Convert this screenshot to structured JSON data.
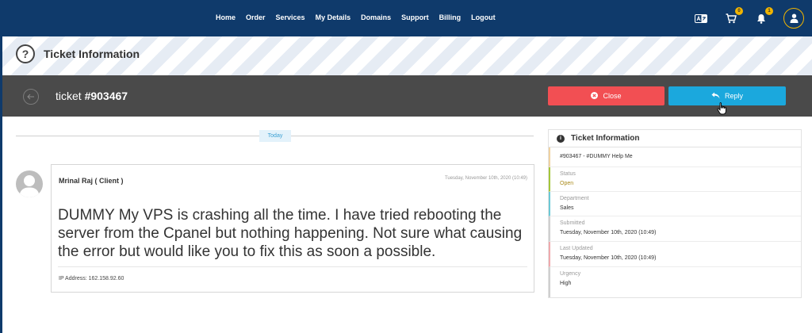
{
  "nav": {
    "items": [
      "Home",
      "Order",
      "Services",
      "My Details",
      "Domains",
      "Support",
      "Billing",
      "Logout"
    ],
    "cart_count": "0",
    "notification_count": "1"
  },
  "header": {
    "title": "Ticket Information"
  },
  "ticket": {
    "title_prefix": "ticket ",
    "number": "#903467",
    "close_label": "Close",
    "reply_label": "Reply"
  },
  "thread": {
    "day_label": "Today",
    "author": "Mrinal Raj ( Client )",
    "date": "Tuesday, November 10th, 2020 (10:49)",
    "body": "DUMMY My VPS is crashing all the time. I have tried rebooting the server from the Cpanel but nothing happening. Not sure what causing the error but would like you to fix this as soon a possible.",
    "ip": "IP Address: 162.158.92.60"
  },
  "side": {
    "title": "Ticket Information",
    "ref": "#903467 - #DUMMY Help Me",
    "rows": [
      {
        "label": "Status",
        "value": "Open"
      },
      {
        "label": "Department",
        "value": "Sales"
      },
      {
        "label": "Submitted",
        "value": "Tuesday, November 10th, 2020 (10:49)"
      },
      {
        "label": "Last Updated",
        "value": "Tuesday, November 10th, 2020 (10:49)"
      },
      {
        "label": "Urgency",
        "value": "High"
      }
    ]
  },
  "colors": {
    "nav_bg": "#0f3a6b",
    "close_btn": "#f24f53",
    "reply_btn": "#1ba8dd",
    "status_open": "#a98a1a",
    "accent_badge": "#f0b400"
  },
  "icons": [
    "translate-icon",
    "cart-icon",
    "bell-icon",
    "user-icon",
    "help-icon",
    "back-arrow-icon",
    "close-circle-icon",
    "reply-icon",
    "info-icon",
    "cursor-icon"
  ]
}
